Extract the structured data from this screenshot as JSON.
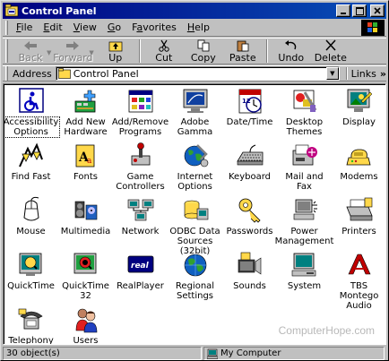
{
  "window": {
    "title": "Control Panel"
  },
  "menu": [
    {
      "pre": "",
      "ul": "F",
      "post": "ile"
    },
    {
      "pre": "",
      "ul": "E",
      "post": "dit"
    },
    {
      "pre": "",
      "ul": "V",
      "post": "iew"
    },
    {
      "pre": "",
      "ul": "G",
      "post": "o"
    },
    {
      "pre": "F",
      "ul": "a",
      "post": "vorites"
    },
    {
      "pre": "",
      "ul": "H",
      "post": "elp"
    }
  ],
  "toolbar": {
    "back": "Back",
    "forward": "Forward",
    "up": "Up",
    "cut": "Cut",
    "copy": "Copy",
    "paste": "Paste",
    "undo": "Undo",
    "delete": "Delete"
  },
  "address": {
    "label": "Address",
    "value": "Control Panel",
    "links": "Links",
    "links_chevron": "»"
  },
  "items": [
    {
      "label": "Accessibility Options",
      "icon": "accessibility-icon"
    },
    {
      "label": "Add New Hardware",
      "icon": "add-new-hardware-icon"
    },
    {
      "label": "Add/Remove Programs",
      "icon": "add-remove-programs-icon"
    },
    {
      "label": "Adobe Gamma",
      "icon": "adobe-gamma-icon"
    },
    {
      "label": "Date/Time",
      "icon": "date-time-icon"
    },
    {
      "label": "Desktop Themes",
      "icon": "desktop-themes-icon"
    },
    {
      "label": "Display",
      "icon": "display-icon"
    },
    {
      "label": "Find Fast",
      "icon": "find-fast-icon"
    },
    {
      "label": "Fonts",
      "icon": "fonts-icon"
    },
    {
      "label": "Game Controllers",
      "icon": "game-controllers-icon"
    },
    {
      "label": "Internet Options",
      "icon": "internet-options-icon"
    },
    {
      "label": "Keyboard",
      "icon": "keyboard-icon"
    },
    {
      "label": "Mail and Fax",
      "icon": "mail-and-fax-icon"
    },
    {
      "label": "Modems",
      "icon": "modems-icon"
    },
    {
      "label": "Mouse",
      "icon": "mouse-icon"
    },
    {
      "label": "Multimedia",
      "icon": "multimedia-icon"
    },
    {
      "label": "Network",
      "icon": "network-icon"
    },
    {
      "label": "ODBC Data Sources (32bit)",
      "icon": "odbc-icon"
    },
    {
      "label": "Passwords",
      "icon": "passwords-icon"
    },
    {
      "label": "Power Management",
      "icon": "power-management-icon"
    },
    {
      "label": "Printers",
      "icon": "printers-icon"
    },
    {
      "label": "QuickTime",
      "icon": "quicktime-icon"
    },
    {
      "label": "QuickTime 32",
      "icon": "quicktime-32-icon"
    },
    {
      "label": "RealPlayer",
      "icon": "realplayer-icon"
    },
    {
      "label": "Regional Settings",
      "icon": "regional-settings-icon"
    },
    {
      "label": "Sounds",
      "icon": "sounds-icon"
    },
    {
      "label": "System",
      "icon": "system-icon"
    },
    {
      "label": "TBS Montego Audio",
      "icon": "tbs-montego-audio-icon"
    },
    {
      "label": "Telephony",
      "icon": "telephony-icon"
    },
    {
      "label": "Users",
      "icon": "users-icon"
    }
  ],
  "watermark": "ComputerHope.com",
  "status": {
    "count": "30 object(s)",
    "location": "My Computer"
  },
  "colors": {
    "title_start": "#000080",
    "title_end": "#0850b8",
    "face": "#c0c0c0"
  }
}
